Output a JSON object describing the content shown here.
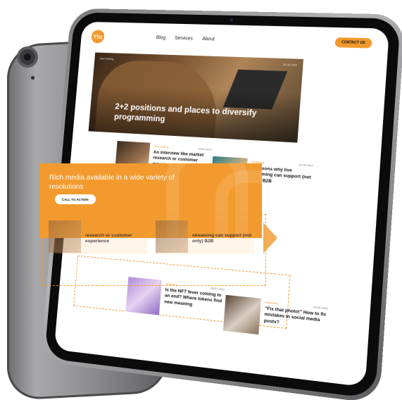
{
  "colors": {
    "accent": "#f39a2e",
    "device": "#8e8e90",
    "screen": "#ffffff"
  },
  "nav": {
    "logo_text": "Yhz",
    "links": [
      "Blog",
      "Services",
      "About"
    ],
    "contact_label": "CONTACT US"
  },
  "hero": {
    "tag": "User testing",
    "date": "03.05.2022",
    "title": "2+2 positions and places to diversify programming"
  },
  "cards_top": [
    {
      "tag": "User testing",
      "date": "03.02.2022",
      "title": "An interview like market research or customer experience"
    },
    {
      "tag": "Marketing",
      "date": "04.08.2022",
      "title": "6 reasons why live streaming can support (not only) B2B"
    }
  ],
  "promo": {
    "title": "Rich media available in a wide variety of resolutions",
    "cta_label": "CALL TO ACTION"
  },
  "ghost_cards": [
    {
      "title": "research or customer experience"
    },
    {
      "title": "streaming can support (not only) B2B"
    }
  ],
  "cards_bottom": [
    {
      "tag": "Marketing",
      "date": "03.07.2022",
      "title": "Is the NFT fever coming to an end? Where tokens find new meaning"
    },
    {
      "tag": "Marketing",
      "date": "04.05.2022",
      "title": "\"Fix that photo!\" How to fix mistakes in social media posts?"
    }
  ]
}
